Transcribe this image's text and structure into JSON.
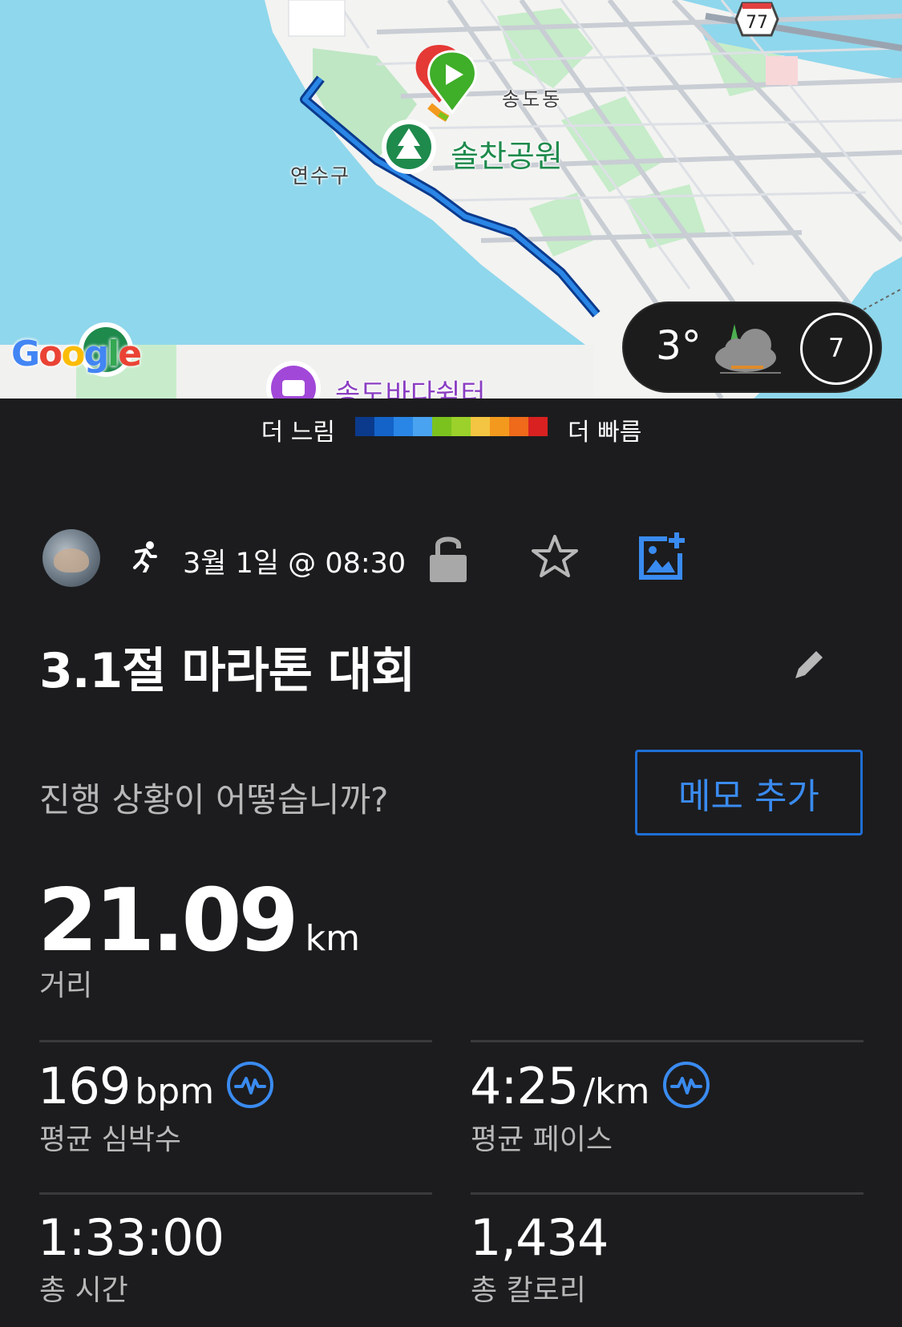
{
  "map": {
    "labels": {
      "district_songdo": "송도동",
      "district_yeonsu": "연수구",
      "park": "솔찬공원",
      "center": "송도바다쉼터"
    },
    "route_shield": "77",
    "google_logo": "Google",
    "weather": {
      "temperature": "3°",
      "icon": "cloud-icon",
      "dial_value": "7"
    }
  },
  "pace_legend": {
    "slow_label": "더 느림",
    "fast_label": "더 빠름",
    "colors": [
      "#0b3a8c",
      "#1463c8",
      "#2a86e6",
      "#4aa3f0",
      "#7cc21f",
      "#9bd12a",
      "#f4c542",
      "#f39a1e",
      "#ef6a1a",
      "#d92121"
    ]
  },
  "activity": {
    "activity_icon": "running-icon",
    "date": "3월 1일 @ 08:30",
    "title": "3.1절 마라톤 대회",
    "note_prompt": "진행 상황이 어떻습니까?",
    "memo_button": "메모 추가"
  },
  "stats": {
    "distance": {
      "value": "21.09",
      "unit": "km",
      "label": "거리"
    },
    "heart_rate": {
      "value": "169",
      "unit": "bpm",
      "label": "평균 심박수"
    },
    "pace": {
      "value": "4:25",
      "unit": "/km",
      "label": "평균 페이스"
    },
    "time": {
      "value": "1:33:00",
      "label": "총 시간"
    },
    "calories": {
      "value": "1,434",
      "label": "총 칼로리"
    }
  },
  "colors": {
    "background": "#1c1c1e",
    "accent_blue": "#3a8bf0",
    "secondary_text": "#b8b8b8",
    "divider": "#3a3a3c"
  }
}
